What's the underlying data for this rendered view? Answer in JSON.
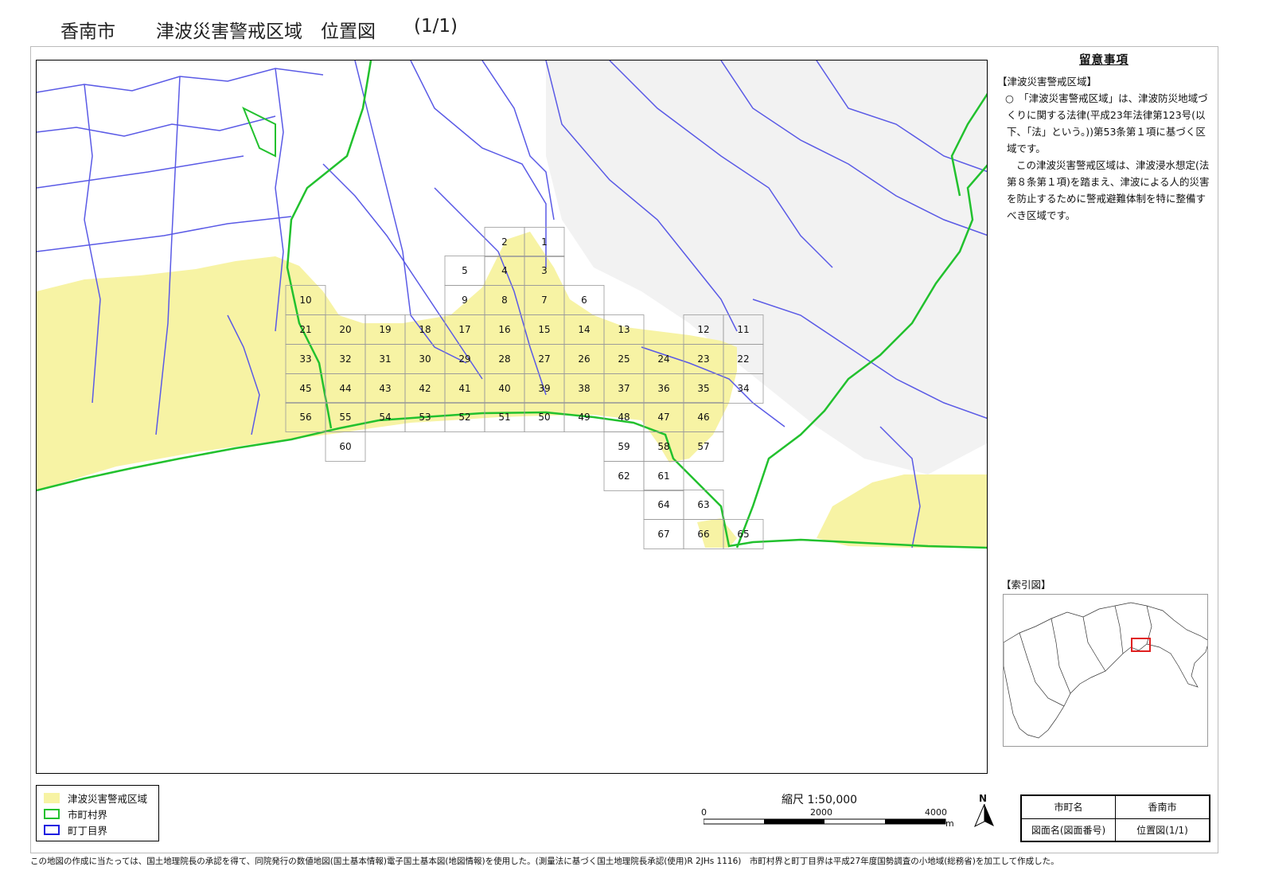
{
  "title": {
    "city": "香南市",
    "main": "津波災害警戒区域　位置図",
    "page": "(1/1)"
  },
  "notes": {
    "heading": "留意事項",
    "section_title": "【津波災害警戒区域】",
    "paragraph1": "○　「津波災害警戒区域」は、津波防災地域づくりに関する法律(平成23年法律第123号(以下、「法」という。))第53条第１項に基づく区域です。",
    "paragraph2": "この津波災害警戒区域は、津波浸水想定(法第８条第１項)を踏まえ、津波による人的災害を防止するために警戒避難体制を特に整備すべき区域です。"
  },
  "index_map": {
    "label": "【索引図】"
  },
  "legend": {
    "items": [
      {
        "label": "津波災害警戒区域",
        "color": "#f7f3a4",
        "style": "fill"
      },
      {
        "label": "市町村界",
        "color": "#22c12e",
        "style": "outline"
      },
      {
        "label": "町丁目界",
        "color": "#1d1de0",
        "style": "outline"
      }
    ]
  },
  "scale": {
    "caption": "縮尺  1:50,000",
    "tick_0": "0",
    "tick_2000": "2000",
    "tick_4000": "4000",
    "unit": "m"
  },
  "north_label": "N",
  "info_table": {
    "rows": [
      {
        "label": "市町名",
        "value": "香南市"
      },
      {
        "label": "図面名(図面番号)",
        "value": "位置図(1/1)"
      }
    ]
  },
  "grid_numbers": [
    "1",
    "2",
    "3",
    "4",
    "5",
    "6",
    "7",
    "8",
    "9",
    "10",
    "11",
    "12",
    "13",
    "14",
    "15",
    "16",
    "17",
    "18",
    "19",
    "20",
    "21",
    "22",
    "23",
    "24",
    "25",
    "26",
    "27",
    "28",
    "29",
    "30",
    "31",
    "32",
    "33",
    "34",
    "35",
    "36",
    "37",
    "38",
    "39",
    "40",
    "41",
    "42",
    "43",
    "44",
    "45",
    "46",
    "47",
    "48",
    "49",
    "50",
    "51",
    "52",
    "53",
    "54",
    "55",
    "56",
    "57",
    "58",
    "59",
    "60",
    "61",
    "62",
    "63",
    "64",
    "65",
    "66",
    "67"
  ],
  "footer": "この地図の作成に当たっては、国土地理院長の承認を得て、同院発行の数値地図(国土基本情報)電子国土基本図(地図情報)を使用した。(測量法に基づく国土地理院長承認(使用)R 2JHs 1116)　市町村界と町丁目界は平成27年度国勢調査の小地域(総務省)を加工して作成した。",
  "colors": {
    "warning_zone": "#f7f3a4",
    "municipal_boundary": "#22c12e",
    "district_boundary": "#5a5ae6",
    "index_highlight": "#e02020"
  }
}
